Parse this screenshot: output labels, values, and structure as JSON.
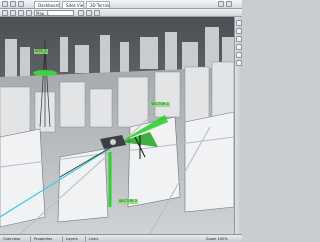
{
  "window": {
    "title": "3D city network planning view"
  },
  "tabs": [
    {
      "label": "Dashboard"
    },
    {
      "label": "Sites View"
    },
    {
      "label": "3D Terrain"
    }
  ],
  "toolbar": {
    "address": "Map_1"
  },
  "labels3d": [
    {
      "text": "SITE_1"
    },
    {
      "text": "SECTOR 1"
    },
    {
      "text": "SECTOR 2"
    }
  ],
  "statusbar": {
    "items": [
      {
        "label": "Overview"
      },
      {
        "label": "Properties"
      },
      {
        "label": "Layers"
      },
      {
        "label": "Links"
      },
      {
        "label": "Zoom 100%"
      }
    ]
  },
  "icons": [
    "back-icon",
    "forward-icon",
    "home-icon",
    "zoom-icon",
    "rotate-icon",
    "pan-icon"
  ],
  "colors": {
    "accent_green": "#2fd12f",
    "link_cyan": "#35d0df",
    "sky_dark": "#56595e"
  }
}
